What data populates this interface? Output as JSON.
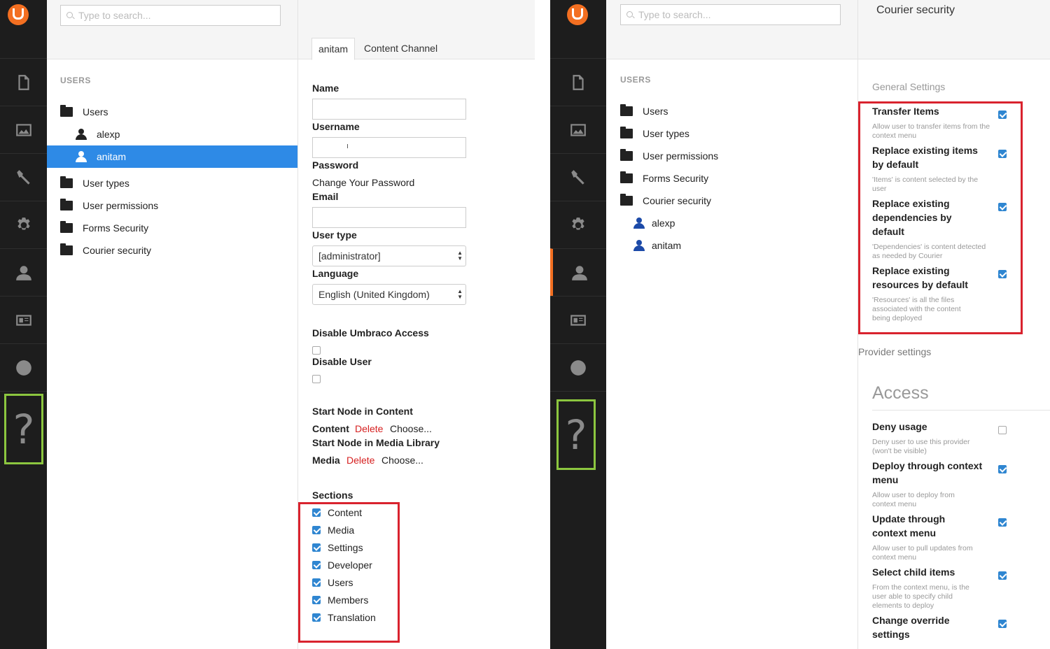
{
  "left": {
    "search_placeholder": "Type to search...",
    "tree_title": "USERS",
    "tree": [
      {
        "label": "Users",
        "icon": "folder-icon"
      },
      {
        "label": "alexp",
        "icon": "user-icon"
      },
      {
        "label": "anitam",
        "icon": "user-icon",
        "selected": true
      },
      {
        "label": "User types",
        "icon": "folder-icon"
      },
      {
        "label": "User permissions",
        "icon": "folder-icon"
      },
      {
        "label": "Forms Security",
        "icon": "folder-icon"
      },
      {
        "label": "Courier security",
        "icon": "folder-icon"
      }
    ],
    "tabs": [
      "anitam",
      "Content Channel"
    ],
    "form": {
      "name_label": "Name",
      "username_label": "Username",
      "username_value": "ı",
      "password_label": "Password",
      "change_password": "Change Your Password",
      "email_label": "Email",
      "usertype_label": "User type",
      "usertype_value": "[administrator]",
      "language_label": "Language",
      "language_value": "English (United Kingdom)",
      "disable_access_label": "Disable Umbraco Access",
      "disable_user_label": "Disable User",
      "start_content_label": "Start Node in Content",
      "content_word": "Content",
      "media_label": "Start Node in Media Library",
      "media_word": "Media",
      "delete_text": "Delete",
      "choose_text": "Choose...",
      "sections_label": "Sections",
      "sections": [
        "Content",
        "Media",
        "Settings",
        "Developer",
        "Users",
        "Members",
        "Translation"
      ]
    },
    "help": "?"
  },
  "right": {
    "search_placeholder": "Type to search...",
    "tree_title": "USERS",
    "tree": [
      {
        "label": "Users",
        "icon": "folder-icon"
      },
      {
        "label": "User types",
        "icon": "folder-icon"
      },
      {
        "label": "User permissions",
        "icon": "folder-icon"
      },
      {
        "label": "Forms Security",
        "icon": "folder-icon"
      },
      {
        "label": "Courier security",
        "icon": "folder-icon"
      },
      {
        "label": "alexp",
        "icon": "user-icon"
      },
      {
        "label": "anitam",
        "icon": "user-icon"
      }
    ],
    "title": "Courier security",
    "general_settings": "General Settings",
    "settings": [
      {
        "label": "Transfer Items",
        "desc": "Allow user to transfer items from the context menu",
        "checked": true
      },
      {
        "label": "Replace existing items by default",
        "desc": "'Items' is content selected by the user",
        "checked": true
      },
      {
        "label": "Replace existing dependencies by default",
        "desc": "'Dependencies' is content detected as needed by Courier",
        "checked": true
      },
      {
        "label": "Replace existing resources by default",
        "desc": "'Resources' is all the files associated with the content being deployed",
        "checked": true
      }
    ],
    "provider_settings": "Provider settings",
    "access_title": "Access",
    "access": [
      {
        "label": "Deny usage",
        "desc": "Deny user to use this provider (won't be visible)",
        "checked": false
      },
      {
        "label": "Deploy through context menu",
        "desc": "Allow user to deploy from context menu",
        "checked": true
      },
      {
        "label": "Update through context menu",
        "desc": "Allow user to pull updates from context menu",
        "checked": true
      },
      {
        "label": "Select child items",
        "desc": "From the context menu, is the user able to specify child elements to deploy",
        "checked": true
      },
      {
        "label": "Change override settings",
        "desc": "",
        "checked": true
      }
    ],
    "help": "?"
  },
  "colors": {
    "accent": "#f36f21",
    "selected": "#2e8ae6",
    "highlight_red": "#d9232e",
    "highlight_green": "#8cc63f",
    "checkbox": "#2f86d1"
  }
}
